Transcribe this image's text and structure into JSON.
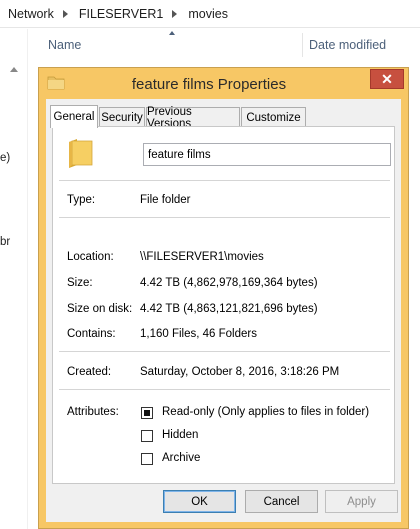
{
  "explorer": {
    "breadcrumb": [
      "Network",
      "FILESERVER1",
      "movies"
    ],
    "columns": {
      "name": "Name",
      "date_modified": "Date modified"
    },
    "side_fragments": [
      "e)",
      "br"
    ]
  },
  "dialog": {
    "title": "feature films Properties",
    "close_symbol": "✕",
    "tabs": [
      "General",
      "Security",
      "Previous Versions",
      "Customize"
    ],
    "active_tab": "General",
    "folder_name": "feature films",
    "properties": {
      "type_label": "Type:",
      "type_value": "File folder",
      "location_label": "Location:",
      "location_value": "\\\\FILESERVER1\\movies",
      "size_label": "Size:",
      "size_value": "4.42 TB (4,862,978,169,364 bytes)",
      "size_on_disk_label": "Size on disk:",
      "size_on_disk_value": "4.42 TB (4,863,121,821,696 bytes)",
      "contains_label": "Contains:",
      "contains_value": "1,160 Files, 46 Folders",
      "created_label": "Created:",
      "created_value": "Saturday, October 8, 2016, 3:18:26 PM",
      "attributes_label": "Attributes:"
    },
    "attributes": {
      "readonly_label": "Read-only (Only applies to files in folder)",
      "readonly_state": "indeterminate",
      "hidden_label": "Hidden",
      "hidden_checked": false,
      "archive_label": "Archive",
      "archive_checked": false
    },
    "buttons": {
      "ok": "OK",
      "cancel": "Cancel",
      "apply": "Apply"
    },
    "colors": {
      "frame": "#f7c765",
      "close_button": "#c7503f",
      "default_button_border": "#3c7fb1"
    }
  }
}
